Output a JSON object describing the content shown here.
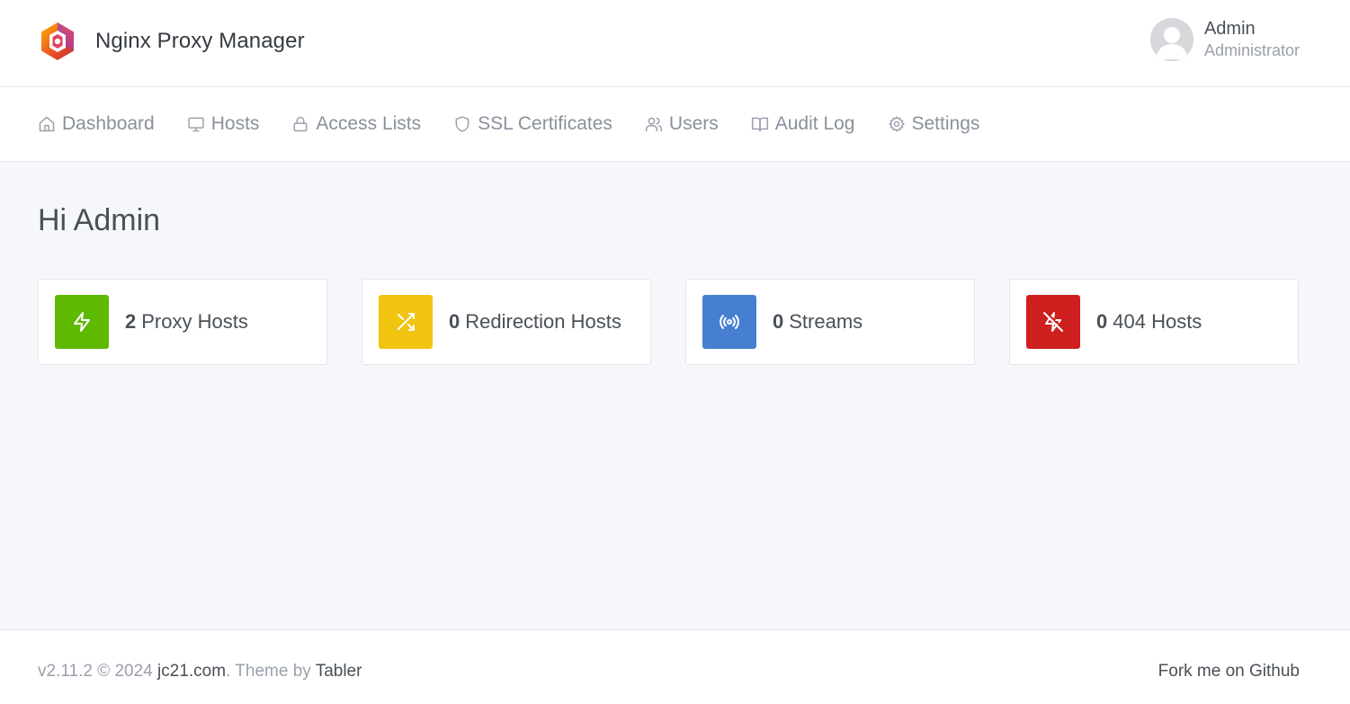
{
  "header": {
    "app_name": "Nginx Proxy Manager",
    "user": {
      "name": "Admin",
      "role": "Administrator"
    }
  },
  "nav": {
    "items": [
      {
        "label": "Dashboard",
        "icon": "home-icon"
      },
      {
        "label": "Hosts",
        "icon": "monitor-icon"
      },
      {
        "label": "Access Lists",
        "icon": "lock-icon"
      },
      {
        "label": "SSL Certificates",
        "icon": "shield-icon"
      },
      {
        "label": "Users",
        "icon": "users-icon"
      },
      {
        "label": "Audit Log",
        "icon": "book-icon"
      },
      {
        "label": "Settings",
        "icon": "gear-icon"
      }
    ]
  },
  "main": {
    "greeting": "Hi Admin",
    "cards": [
      {
        "count": "2",
        "label": "Proxy Hosts",
        "icon": "zap-icon",
        "color": "#5eba00"
      },
      {
        "count": "0",
        "label": "Redirection Hosts",
        "icon": "shuffle-icon",
        "color": "#f1c40f"
      },
      {
        "count": "0",
        "label": "Streams",
        "icon": "radio-icon",
        "color": "#467fcf"
      },
      {
        "count": "0",
        "label": "404 Hosts",
        "icon": "zap-off-icon",
        "color": "#cd201f"
      }
    ]
  },
  "footer": {
    "version": "v2.11.2 © 2024",
    "company_link": "jc21.com",
    "theme_prefix": ". Theme by",
    "theme_link": "Tabler",
    "github_link": "Fork me on Github"
  }
}
